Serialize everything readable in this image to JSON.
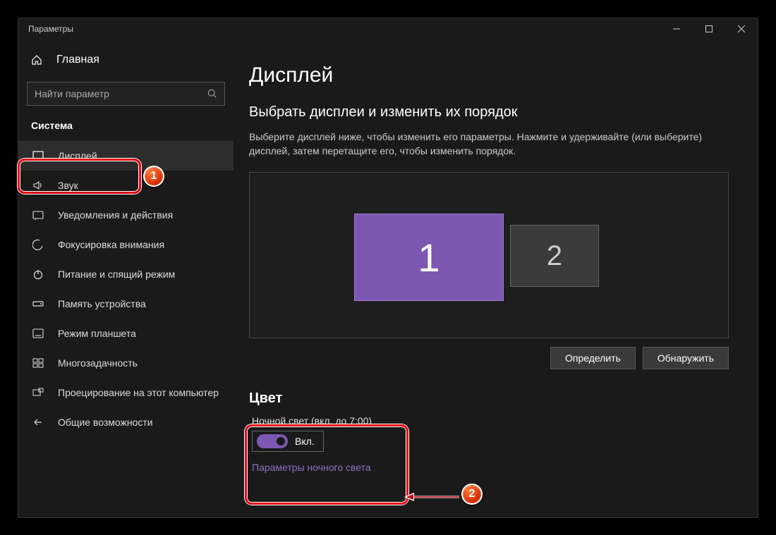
{
  "window_title": "Параметры",
  "sidebar": {
    "home": "Главная",
    "search_placeholder": "Найти параметр",
    "section": "Система",
    "items": [
      {
        "label": "Дисплей"
      },
      {
        "label": "Звук"
      },
      {
        "label": "Уведомления и действия"
      },
      {
        "label": "Фокусировка внимания"
      },
      {
        "label": "Питание и спящий режим"
      },
      {
        "label": "Память устройства"
      },
      {
        "label": "Режим планшета"
      },
      {
        "label": "Многозадачность"
      },
      {
        "label": "Проецирование на этот компьютер"
      },
      {
        "label": "Общие возможности"
      }
    ]
  },
  "main": {
    "title": "Дисплей",
    "arrange_title": "Выбрать дисплеи и изменить их порядок",
    "arrange_desc": "Выберите дисплей ниже, чтобы изменить его параметры. Нажмите и удерживайте (или выберите) дисплей, затем перетащите его, чтобы изменить порядок.",
    "monitor1": "1",
    "monitor2": "2",
    "identify": "Определить",
    "detect": "Обнаружить",
    "color_section": "Цвет",
    "nightlight_label": "Ночной свет (вкл. до 7:00)",
    "toggle_state": "Вкл.",
    "nightlight_link": "Параметры ночного света"
  },
  "annotations": {
    "b1": "1",
    "b2": "2"
  }
}
